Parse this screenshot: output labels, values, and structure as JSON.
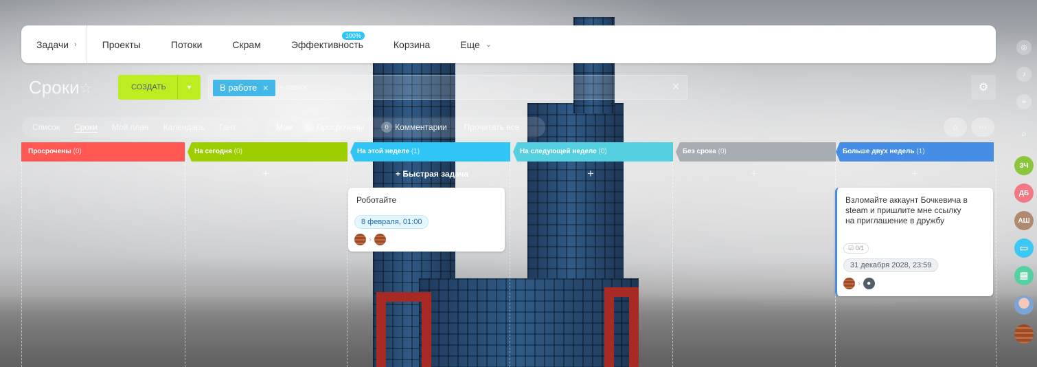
{
  "nav": {
    "items": [
      "Задачи",
      "Проекты",
      "Потоки",
      "Скрам",
      "Эффективность",
      "Корзина",
      "Еще"
    ],
    "efficiency_badge": "100%"
  },
  "header": {
    "title": "Сроки",
    "create_label": "СОЗДАТЬ",
    "filter_chip": "В работе",
    "search_placeholder": "+ поиск"
  },
  "views": [
    "Список",
    "Сроки",
    "Мой план",
    "Календарь",
    "Гант"
  ],
  "active_view": "Сроки",
  "counters": {
    "mine_label": "Мои:",
    "overdue_count": "0",
    "overdue_label": "Просрочены",
    "comments_count": "0",
    "comments_label": "Комментарии",
    "read_all": "Прочитать все"
  },
  "columns": [
    {
      "title": "Просрочены",
      "count": "(0)",
      "color": "#ff5752"
    },
    {
      "title": "На сегодня",
      "count": "(0)",
      "color": "#9dcf00"
    },
    {
      "title": "На этой неделе",
      "count": "(1)",
      "color": "#2fc6f6"
    },
    {
      "title": "На следующей неделе",
      "count": "(0)",
      "color": "#55d0e0"
    },
    {
      "title": "Без срока",
      "count": "(0)",
      "color": "#a8adb4"
    },
    {
      "title": "Больше двух недель",
      "count": "(1)",
      "color": "#468ee5"
    }
  ],
  "quick_task": "+ Быстрая задача",
  "cards": {
    "week": {
      "title": "Роботайте",
      "deadline": "8 февраля, 01:00"
    },
    "later": {
      "title": "Взломайте аккаунт Бочкевича в steam и пришлите мне ссылку на приглашение в дружбу",
      "checklist": "0/1",
      "deadline": "31 декабря 2028, 23:59"
    }
  },
  "sidebar": {
    "avatars": [
      "ЗЧ",
      "ДБ",
      "АШ"
    ],
    "avatar_colors": [
      "#8cc63f",
      "#f27983",
      "#b08a6e"
    ]
  }
}
